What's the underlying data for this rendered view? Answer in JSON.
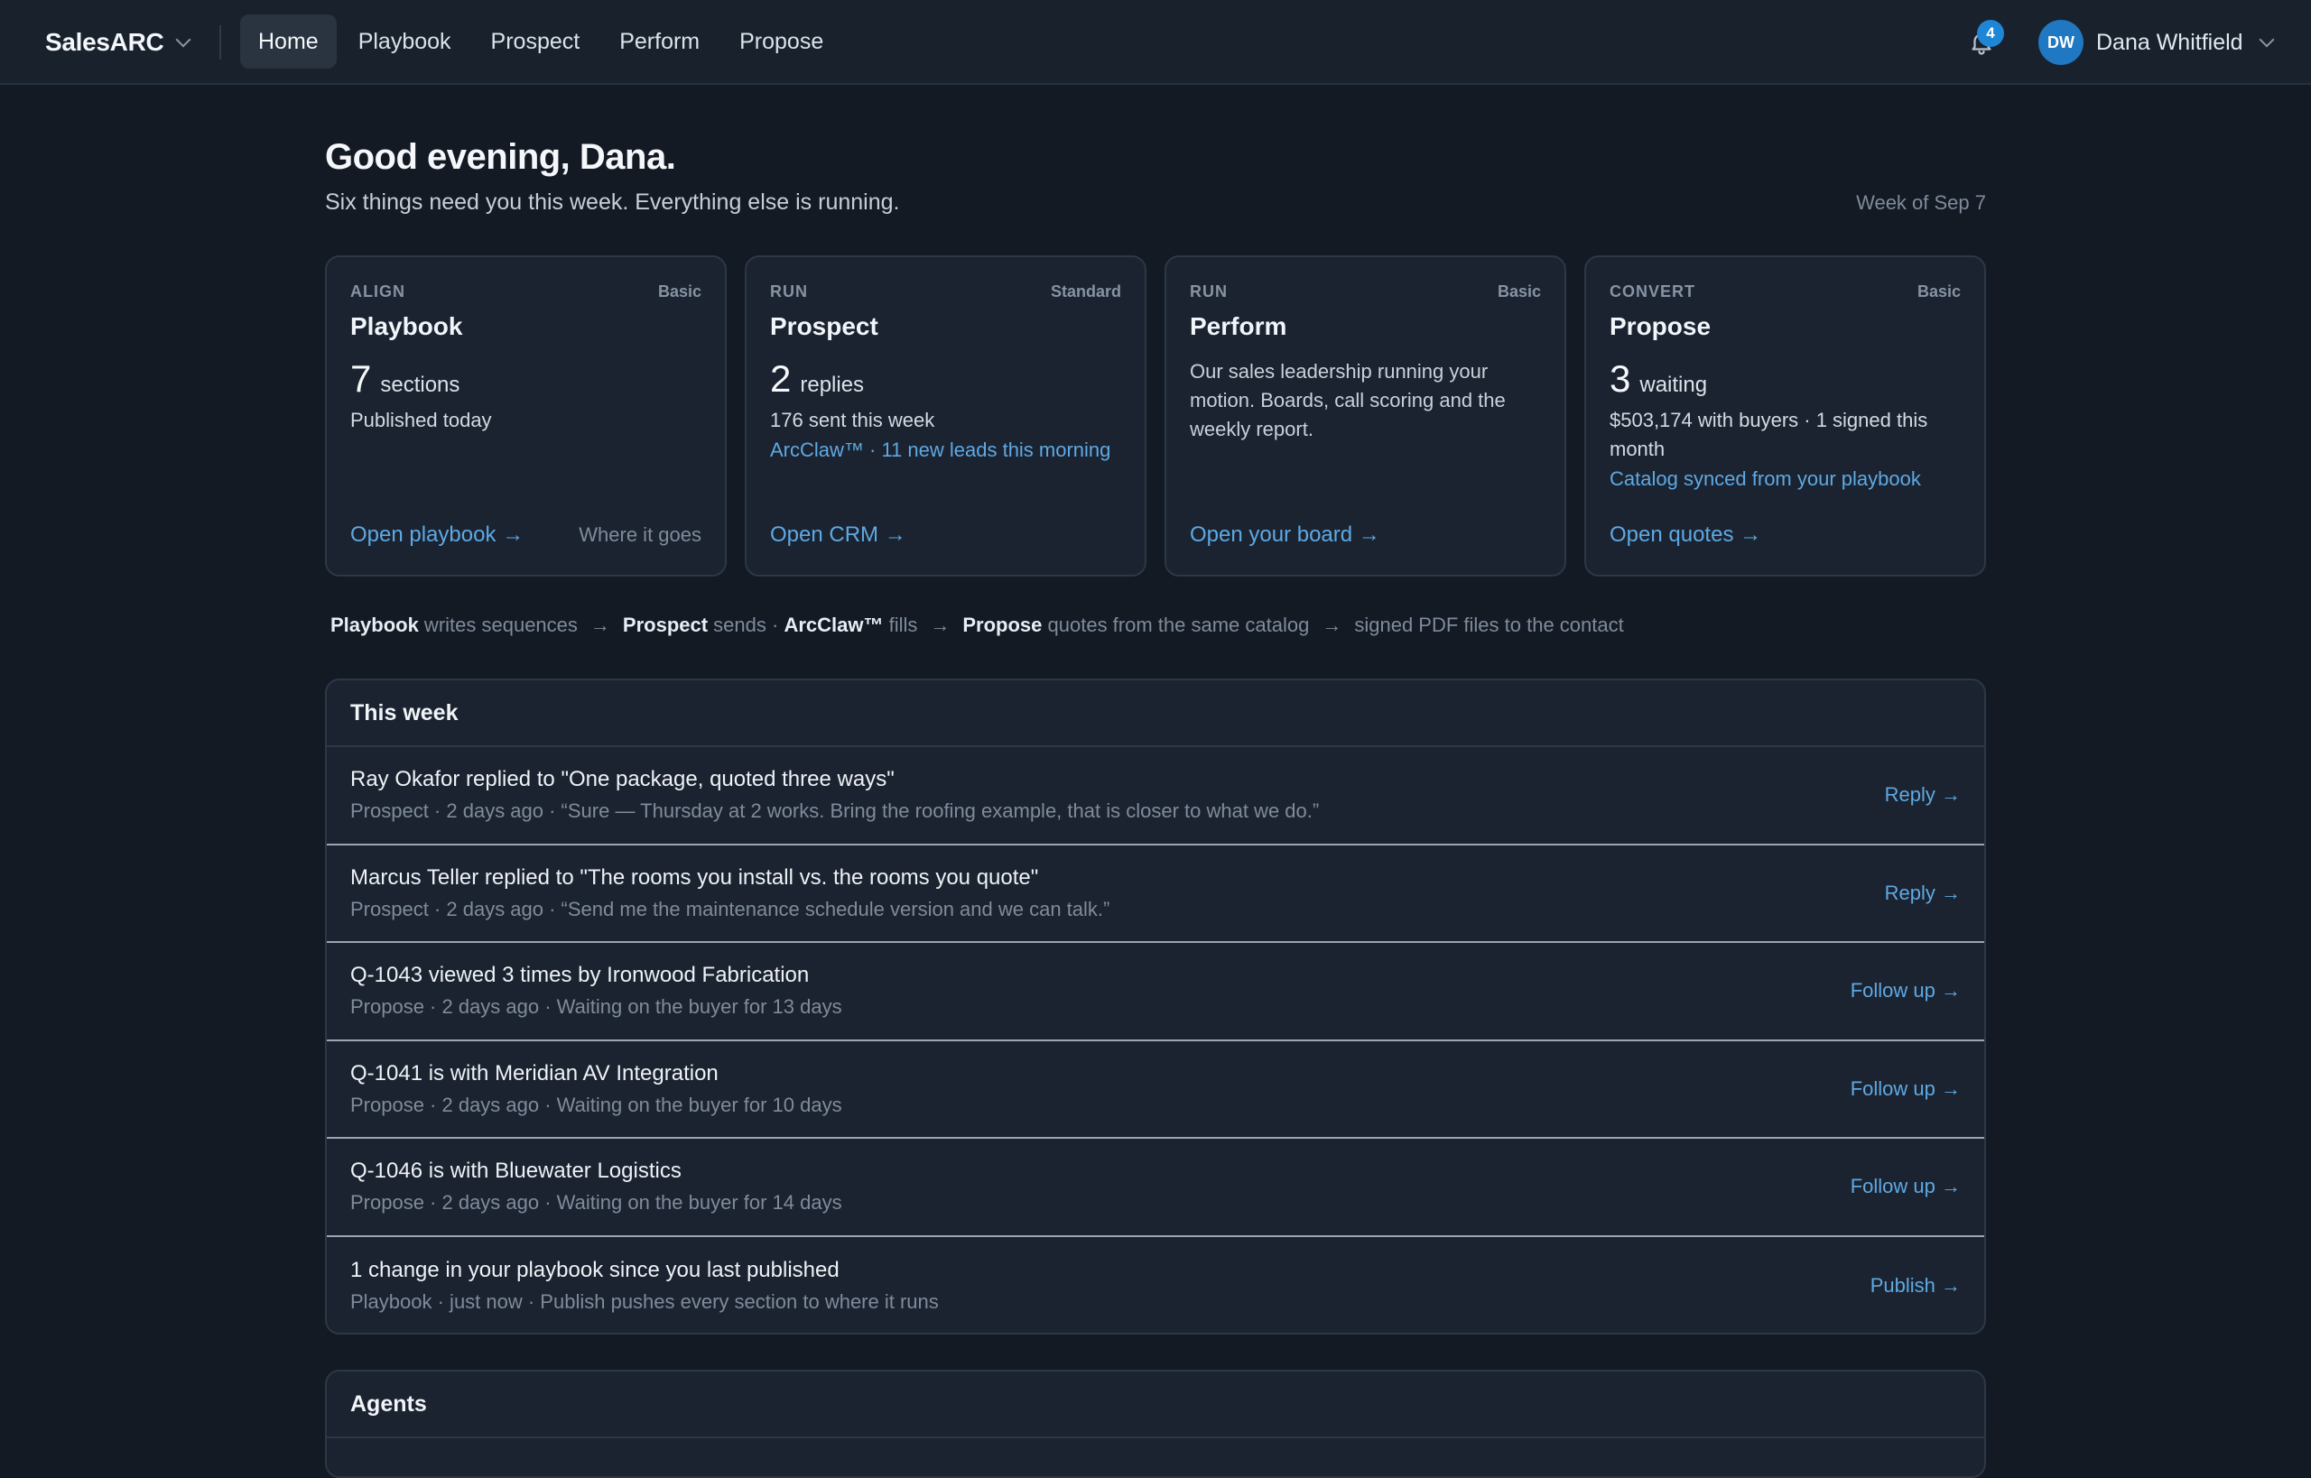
{
  "brand": "SalesARC",
  "nav": [
    {
      "label": "Home",
      "active": true
    },
    {
      "label": "Playbook"
    },
    {
      "label": "Prospect"
    },
    {
      "label": "Perform"
    },
    {
      "label": "Propose"
    }
  ],
  "notifications": {
    "count": "4"
  },
  "user": {
    "initials": "DW",
    "name": "Dana Whitfield"
  },
  "header": {
    "greeting": "Good evening, Dana.",
    "subtitle": "Six things need you this week. Everything else is running.",
    "week": "Week of Sep 7"
  },
  "cards": [
    {
      "kicker": "ALIGN",
      "tier": "Basic",
      "title": "Playbook",
      "metric": "7",
      "unit": "sections",
      "line": "Published today",
      "link": "Open playbook →",
      "secondary": "Where it goes"
    },
    {
      "kicker": "RUN",
      "tier": "Standard",
      "title": "Prospect",
      "metric": "2",
      "unit": "replies",
      "line": "176 sent this week",
      "highlight": "ArcClaw™ · 11 new leads this morning",
      "link": "Open CRM →"
    },
    {
      "kicker": "RUN",
      "tier": "Basic",
      "title": "Perform",
      "desc": "Our sales leadership running your motion. Boards, call scoring and the weekly report.",
      "link": "Open your board →"
    },
    {
      "kicker": "CONVERT",
      "tier": "Basic",
      "title": "Propose",
      "metric": "3",
      "unit": "waiting",
      "line": "$503,174 with buyers · 1 signed this month",
      "highlight": "Catalog synced from your playbook",
      "link": "Open quotes →"
    }
  ],
  "flow": {
    "p1b": "Playbook",
    "p1": " writes sequences",
    "p2b": "Prospect",
    "p2": " sends · ",
    "p3b": "ArcClaw™",
    "p3": " fills",
    "p4b": "Propose",
    "p4": " quotes from the same catalog",
    "p5": "signed PDF files to the contact",
    "arrow": "→"
  },
  "this_week": {
    "title": "This week",
    "rows": [
      {
        "title": "Ray Okafor replied to \"One package, quoted three ways\"",
        "meta": "Prospect · 2 days ago · “Sure — Thursday at 2 works. Bring the roofing example, that is closer to what we do.”",
        "action": "Reply →"
      },
      {
        "title": "Marcus Teller replied to \"The rooms you install vs. the rooms you quote\"",
        "meta": "Prospect · 2 days ago · “Send me the maintenance schedule version and we can talk.”",
        "action": "Reply →"
      },
      {
        "title": "Q-1043 viewed 3 times by Ironwood Fabrication",
        "meta": "Propose · 2 days ago · Waiting on the buyer for 13 days",
        "action": "Follow up →"
      },
      {
        "title": "Q-1041 is with Meridian AV Integration",
        "meta": "Propose · 2 days ago · Waiting on the buyer for 10 days",
        "action": "Follow up →"
      },
      {
        "title": "Q-1046 is with Bluewater Logistics",
        "meta": "Propose · 2 days ago · Waiting on the buyer for 14 days",
        "action": "Follow up →"
      },
      {
        "title": "1 change in your playbook since you last published",
        "meta": "Playbook · just now · Publish pushes every section to where it runs",
        "action": "Publish →"
      }
    ]
  },
  "agents": {
    "title": "Agents"
  }
}
